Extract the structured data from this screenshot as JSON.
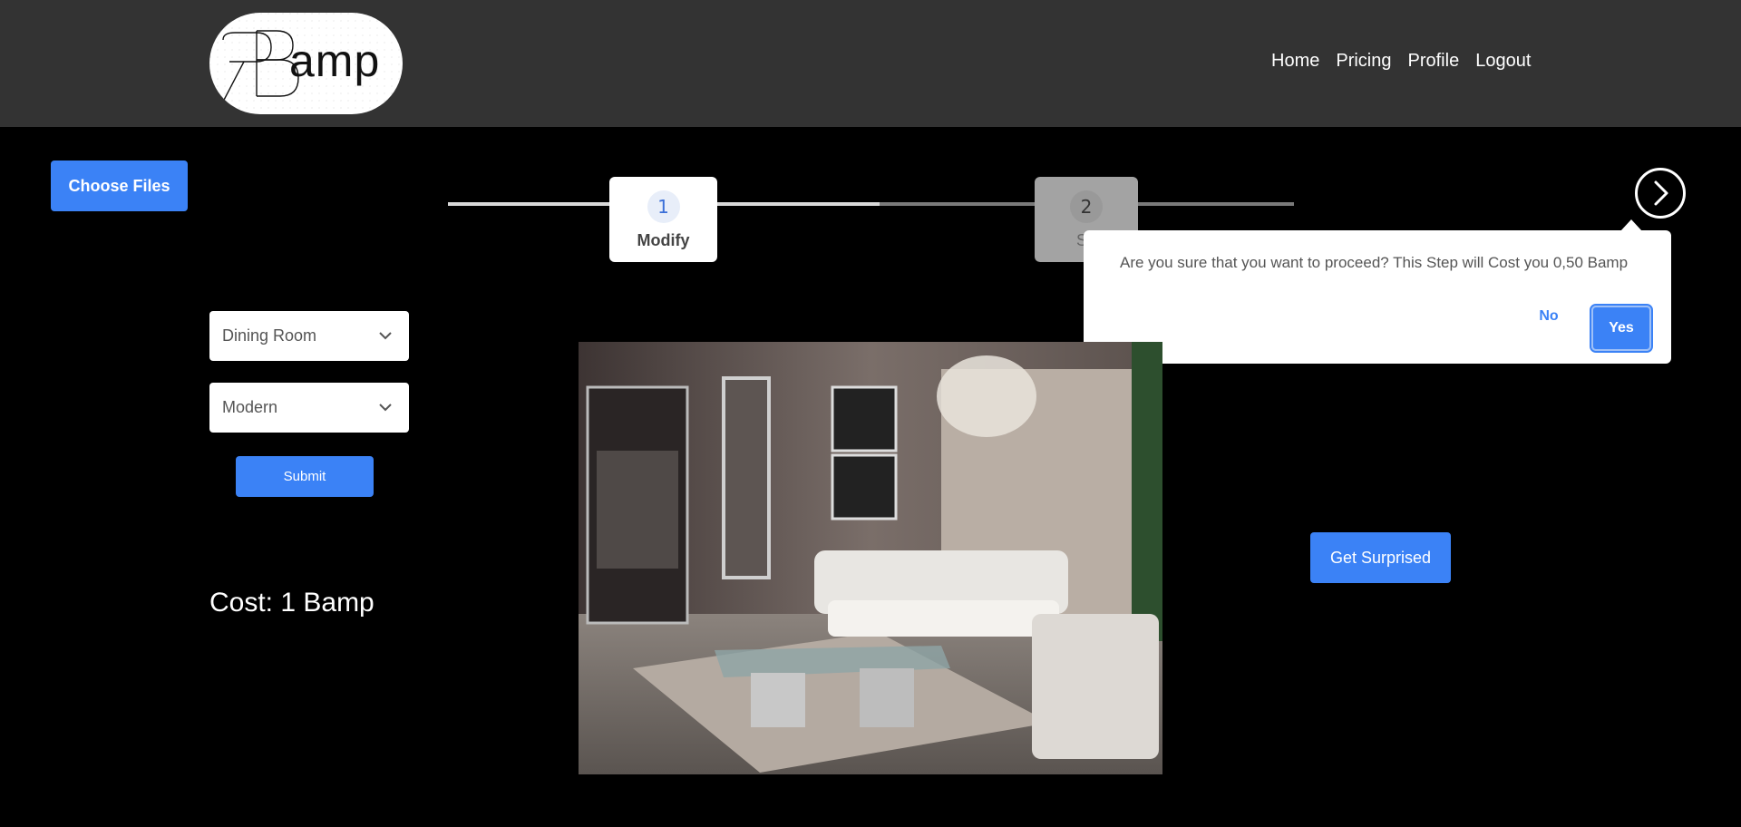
{
  "header": {
    "logo_text": "amp",
    "nav": [
      "Home",
      "Pricing",
      "Profile",
      "Logout"
    ]
  },
  "upload": {
    "choose_files_label": "Choose Files"
  },
  "stepper": {
    "steps": [
      {
        "number": "1",
        "label": "Modify"
      },
      {
        "number": "2",
        "label": "Sh"
      }
    ]
  },
  "confirm": {
    "message": "Are you sure that you want to proceed? This Step will Cost you 0,50 Bamp",
    "no_label": "No",
    "yes_label": "Yes"
  },
  "form": {
    "room_type": "Dining Room",
    "style": "Modern",
    "submit_label": "Submit",
    "cost_text": "Cost: 1 Bamp"
  },
  "actions": {
    "surprise_label": "Get Surprised"
  },
  "colors": {
    "header_bg": "#333333",
    "accent": "#3b82f6",
    "page_bg": "#000000"
  }
}
